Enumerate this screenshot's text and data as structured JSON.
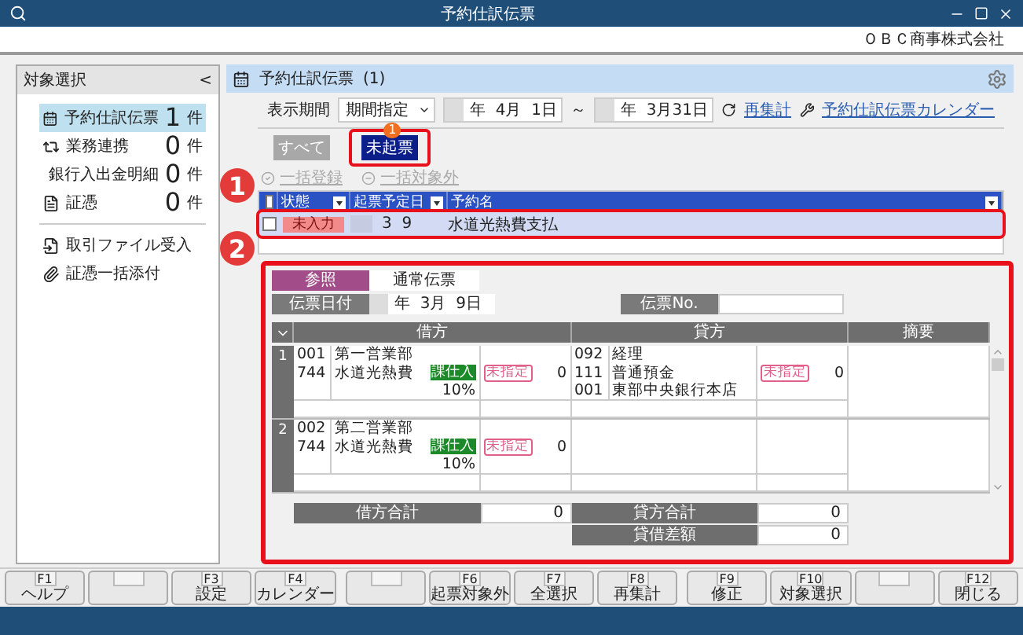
{
  "window": {
    "title": "予約仕訳伝票",
    "company": "ＯＢＣ商事株式会社"
  },
  "sidebar": {
    "title": "対象選択",
    "collapse": "<",
    "items": [
      {
        "label": "予約仕訳伝票",
        "count": "1",
        "unit": "件",
        "selected": true
      },
      {
        "label": "業務連携",
        "count": "0",
        "unit": "件",
        "selected": false
      },
      {
        "label": "銀行入出金明細",
        "count": "0",
        "unit": "件",
        "selected": false
      },
      {
        "label": "証憑",
        "count": "0",
        "unit": "件",
        "selected": false
      }
    ],
    "links": [
      "取引ファイル受入",
      "証憑一括添付"
    ]
  },
  "header": {
    "title": "予約仕訳伝票",
    "count": "(1)"
  },
  "filter": {
    "label": "表示期間",
    "mode": "期間指定",
    "from": "年  4月  1日",
    "separator": "～",
    "to": "年  3月31日",
    "links": [
      "再集計",
      "予約仕訳伝票カレンダー"
    ]
  },
  "status_tabs": [
    {
      "label": "すべて",
      "selected": false,
      "highlighted": false
    },
    {
      "label": "未起票",
      "selected": true,
      "highlighted": true,
      "badge": "1"
    }
  ],
  "actions": [
    {
      "label": "一括登録",
      "disabled": true
    },
    {
      "label": "一括対象外",
      "disabled": true
    }
  ],
  "list": {
    "all_checked": false,
    "columns": [
      "状態",
      "起票予定日",
      "予約名"
    ],
    "rows": [
      {
        "checked": false,
        "selected": true,
        "highlighted": true,
        "status": "未入力",
        "date": "3  9",
        "name": "水道光熱費支払"
      }
    ]
  },
  "callouts": [
    "1",
    "2"
  ],
  "detail": {
    "highlighted": true,
    "type_label": "参照",
    "type_value": "通常伝票",
    "date_label": "伝票日付",
    "date_value": "年  3月  9日",
    "no_label": "伝票No.",
    "columns": [
      "借方",
      "貸方",
      "摘要"
    ],
    "lines": [
      {
        "number": "1",
        "debit": {
          "dept_code": "001",
          "dept": "第一営業部",
          "account_code": "744",
          "account": "水道光熱費",
          "tax": "課仕入",
          "rate": "10%",
          "tax_flag": "未指定",
          "amount": "0"
        },
        "credit": {
          "dept_code": "092",
          "dept": "経理",
          "account_code": "111",
          "account": "普通預金",
          "sub_code": "001",
          "sub": "東部中央銀行本店",
          "tax_flag": "未指定",
          "amount": "0"
        }
      },
      {
        "number": "2",
        "debit": {
          "dept_code": "002",
          "dept": "第二営業部",
          "account_code": "744",
          "account": "水道光熱費",
          "tax": "課仕入",
          "rate": "10%",
          "tax_flag": "未指定",
          "amount": "0"
        }
      }
    ],
    "totals": [
      {
        "label": "借方合計",
        "value": "0"
      },
      {
        "label": "貸方合計",
        "value": "0"
      },
      {
        "label": "貸借差額",
        "value": "0"
      }
    ]
  },
  "function_keys": [
    [
      {
        "kind": "key",
        "key": "F1",
        "label": "ヘルプ"
      },
      {
        "kind": "blank"
      },
      {
        "kind": "key",
        "key": "F3",
        "label": "設定"
      },
      {
        "kind": "key",
        "key": "F4",
        "label": "カレンダー"
      }
    ],
    [
      {
        "kind": "blank"
      },
      {
        "kind": "key",
        "key": "F6",
        "label": "起票対象外"
      },
      {
        "kind": "key",
        "key": "F7",
        "label": "全選択"
      },
      {
        "kind": "key",
        "key": "F8",
        "label": "再集計"
      }
    ],
    [
      {
        "kind": "key",
        "key": "F9",
        "label": "修正"
      },
      {
        "kind": "key",
        "key": "F10",
        "label": "対象選択"
      },
      {
        "kind": "blank"
      },
      {
        "kind": "key",
        "key": "F12",
        "label": "閉じる"
      }
    ]
  ]
}
